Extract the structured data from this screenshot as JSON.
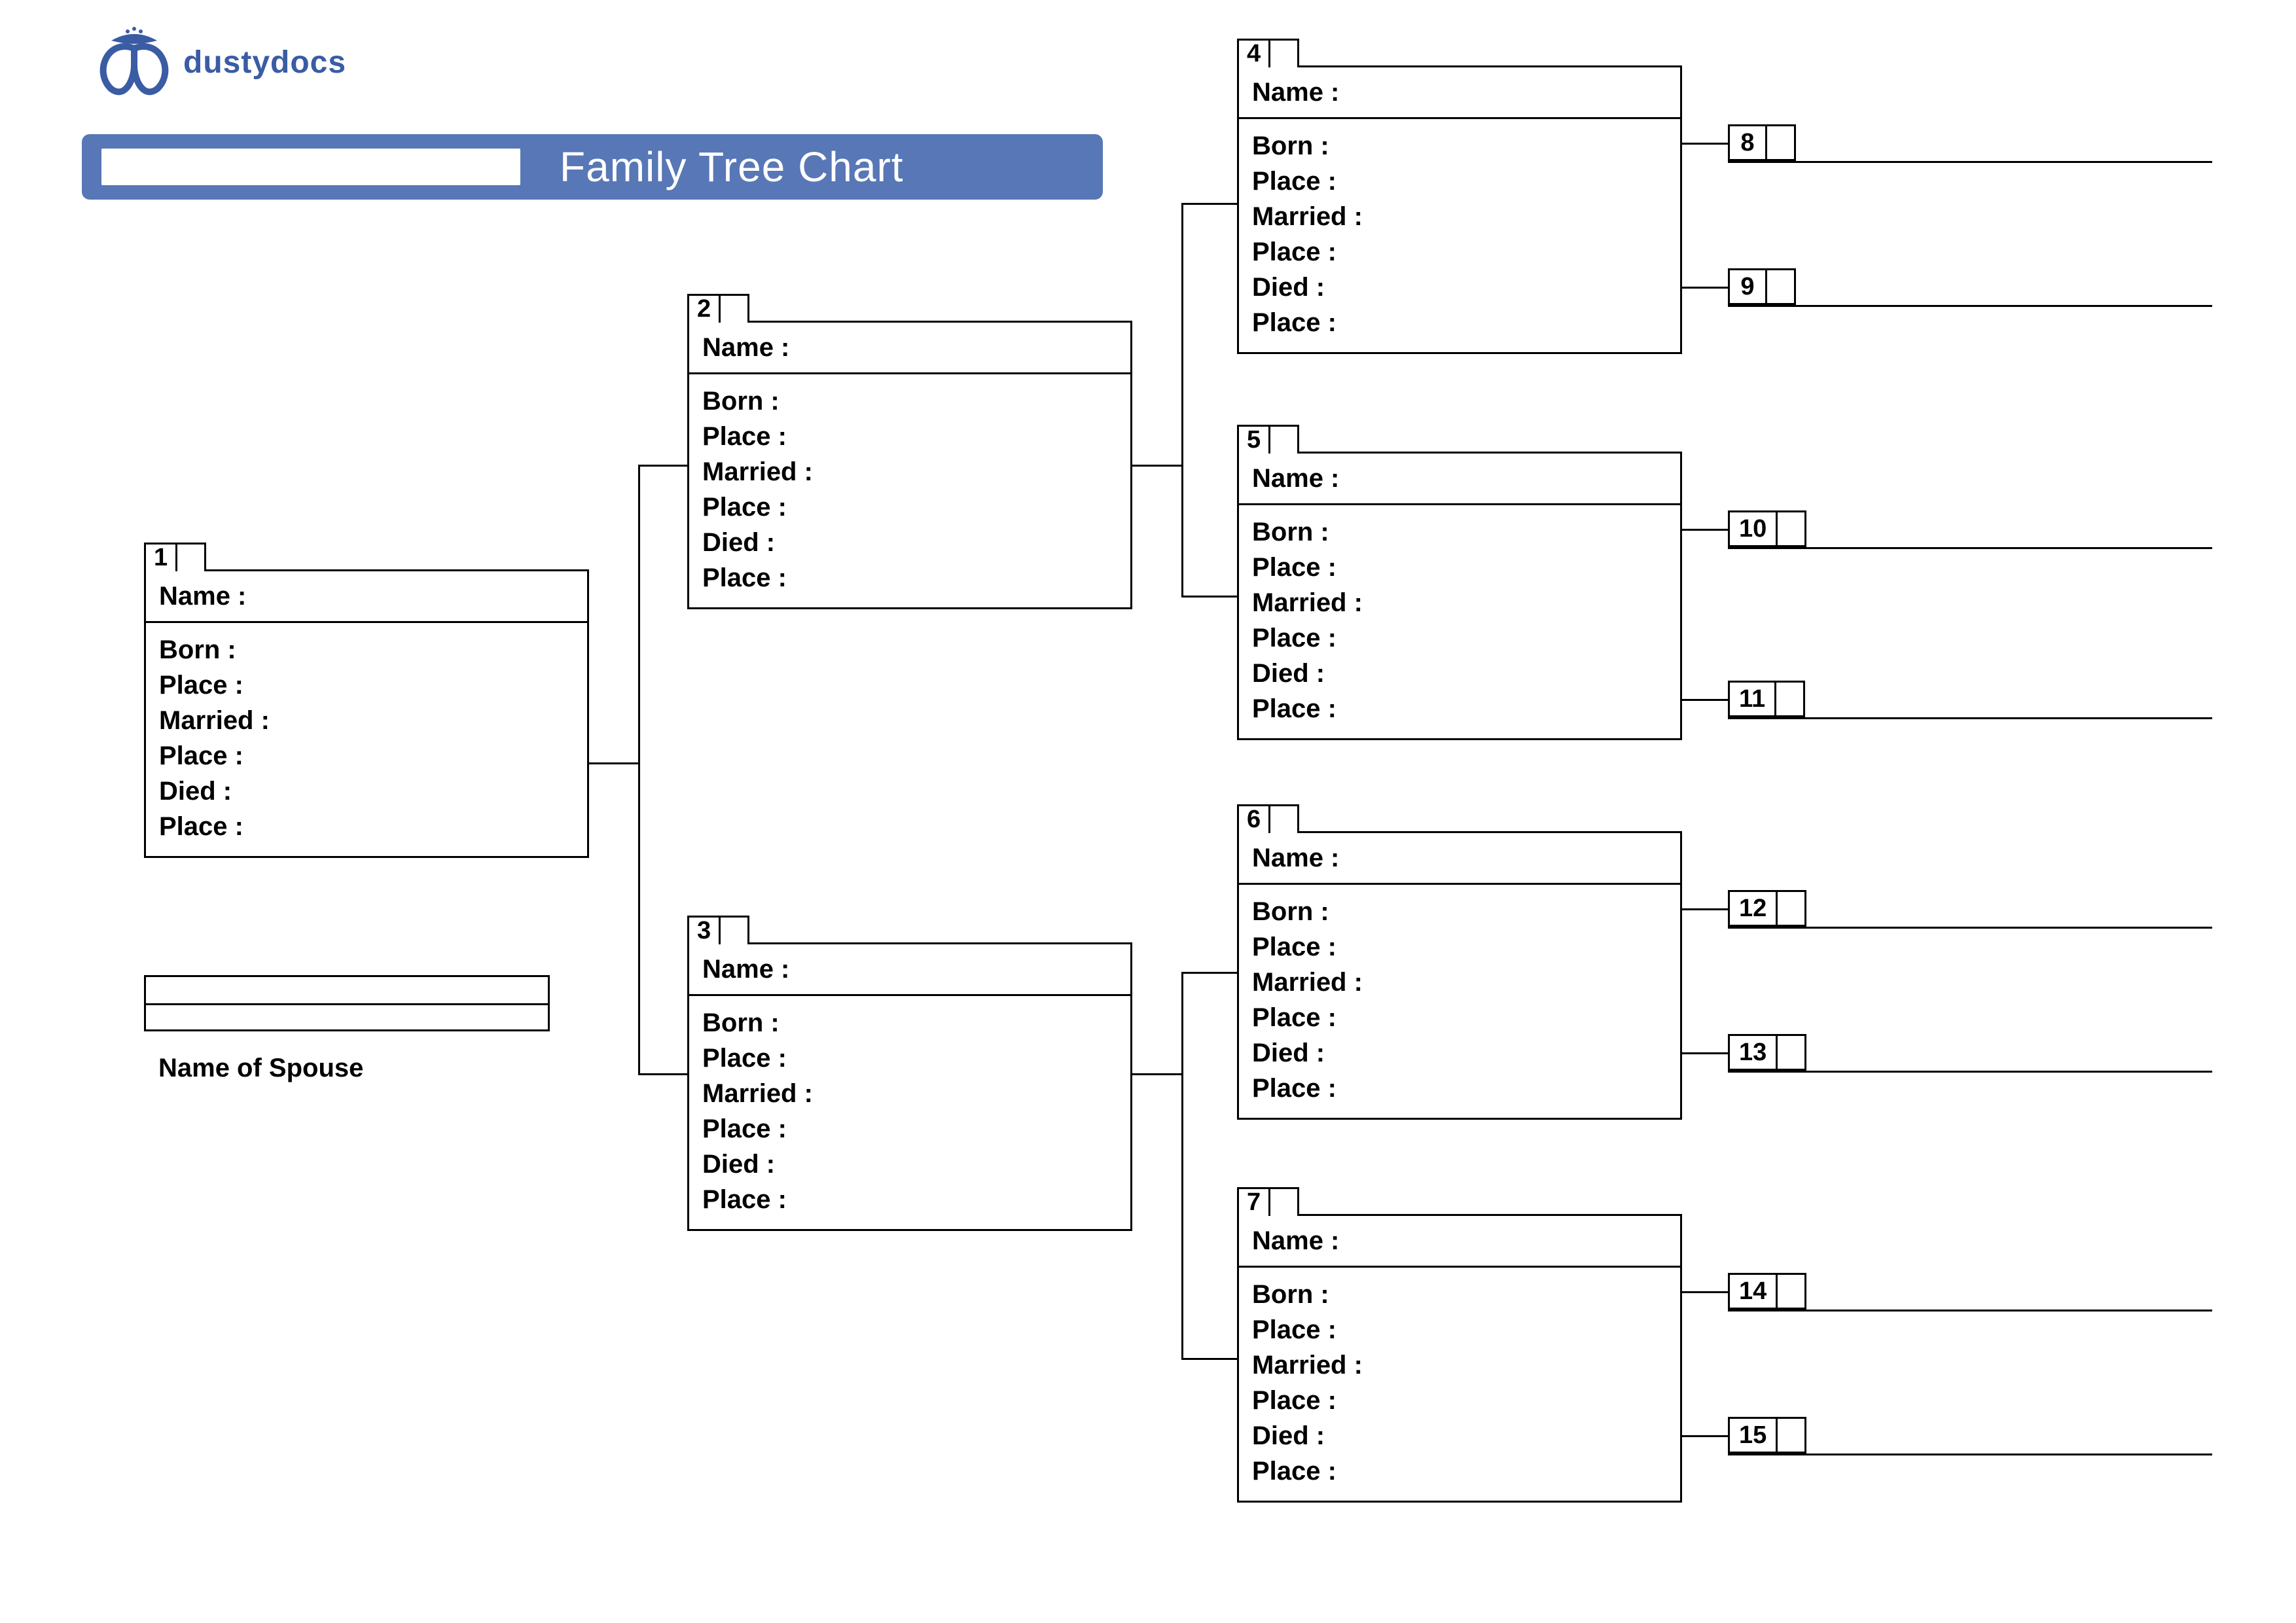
{
  "brand": {
    "name": "dustydocs"
  },
  "title": "Family Tree Chart",
  "labels": {
    "name": "Name :",
    "born": "Born :",
    "place": "Place :",
    "married": "Married :",
    "died": "Died :",
    "spouse": "Name of Spouse"
  },
  "people": {
    "p1": {
      "num": "1"
    },
    "p2": {
      "num": "2"
    },
    "p3": {
      "num": "3"
    },
    "p4": {
      "num": "4"
    },
    "p5": {
      "num": "5"
    },
    "p6": {
      "num": "6"
    },
    "p7": {
      "num": "7"
    }
  },
  "stubs": {
    "s8": {
      "num": "8"
    },
    "s9": {
      "num": "9"
    },
    "s10": {
      "num": "10"
    },
    "s11": {
      "num": "11"
    },
    "s12": {
      "num": "12"
    },
    "s13": {
      "num": "13"
    },
    "s14": {
      "num": "14"
    },
    "s15": {
      "num": "15"
    }
  }
}
